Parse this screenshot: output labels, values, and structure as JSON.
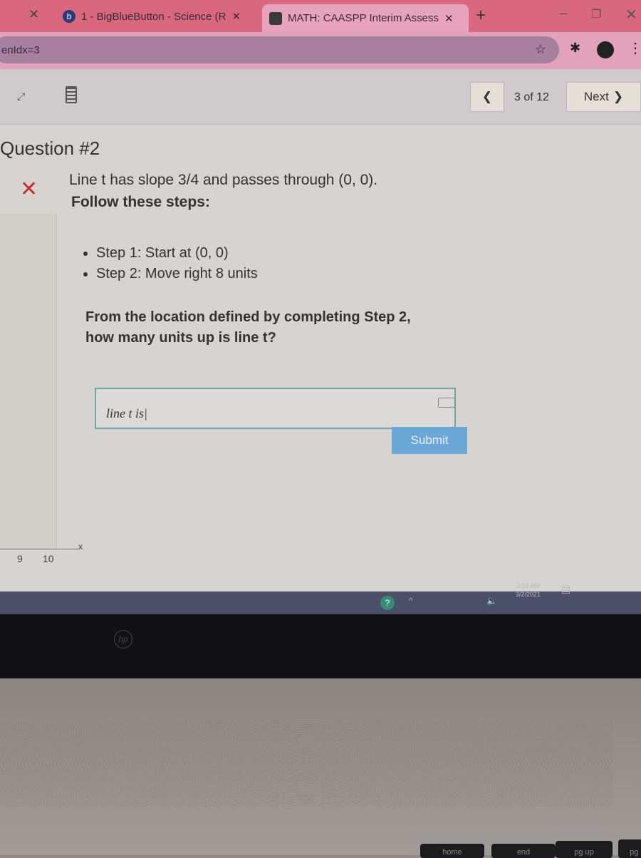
{
  "browser": {
    "tabs": [
      {
        "label": "1 - BigBlueButton - Science (R",
        "icon": "bigbluebutton-icon"
      },
      {
        "label": "MATH: CAASPP Interim Assess",
        "icon": "assessment-icon",
        "active": true
      }
    ],
    "new_tab": "+",
    "address": "enIdx=3"
  },
  "toolbar": {
    "page_indicator": "3 of 12",
    "next_label": "Next",
    "prev_icon": "chevron-left-icon"
  },
  "question": {
    "title": "Question #2",
    "status_icon": "x-mark-icon",
    "line1": "Line t has slope 3/4 and passes through (0, 0).",
    "line2": "Follow these steps:",
    "steps": [
      "Step 1: Start at (0, 0)",
      "Step 2: Move right 8 units"
    ],
    "prompt1": "From the location defined by completing Step 2,",
    "prompt2": "how many units up is line t?",
    "answer_value": "line t is",
    "submit_label": "Submit"
  },
  "graph": {
    "x_ticks": [
      "9",
      "10"
    ],
    "x_axis_label": "x"
  },
  "taskbar": {
    "time": "9:58 AM",
    "date": "3/2/2021"
  },
  "keyboard": {
    "keys": [
      "home",
      "end",
      "pg up",
      "pg dn"
    ]
  },
  "colors": {
    "tabbar": "#d9687f",
    "accent_submit": "#6aa8d8",
    "taskbar": "#4b4f6a"
  }
}
